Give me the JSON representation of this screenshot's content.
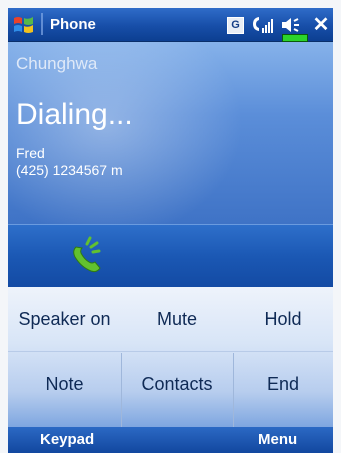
{
  "titlebar": {
    "app_title": "Phone",
    "indicator_letter": "G",
    "icons": [
      "windows-start-icon",
      "signal-icon",
      "speaker-icon",
      "battery-icon",
      "close-icon"
    ],
    "close_label": "✕"
  },
  "call": {
    "operator": "Chunghwa",
    "status": "Dialing...",
    "contact_name": "Fred",
    "contact_number": "(425) 1234567 m"
  },
  "buttons": {
    "speaker": "Speaker on",
    "mute": "Mute",
    "hold": "Hold",
    "note": "Note",
    "contacts": "Contacts",
    "end": "End"
  },
  "softkeys": {
    "left": "Keypad",
    "right": "Menu"
  },
  "colors": {
    "titlebar": "#174ea8",
    "panel": "#5b8ed9",
    "call_icon": "#5fbd2d"
  }
}
